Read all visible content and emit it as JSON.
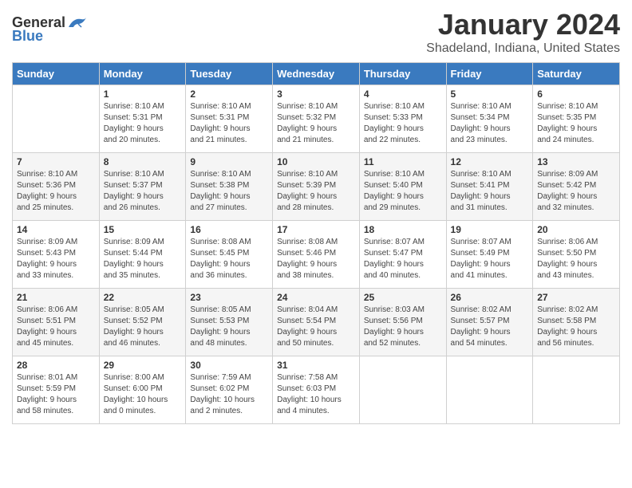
{
  "header": {
    "logo_general": "General",
    "logo_blue": "Blue",
    "month_title": "January 2024",
    "location": "Shadeland, Indiana, United States"
  },
  "days_of_week": [
    "Sunday",
    "Monday",
    "Tuesday",
    "Wednesday",
    "Thursday",
    "Friday",
    "Saturday"
  ],
  "weeks": [
    [
      {
        "day": "",
        "info": ""
      },
      {
        "day": "1",
        "info": "Sunrise: 8:10 AM\nSunset: 5:31 PM\nDaylight: 9 hours\nand 20 minutes."
      },
      {
        "day": "2",
        "info": "Sunrise: 8:10 AM\nSunset: 5:31 PM\nDaylight: 9 hours\nand 21 minutes."
      },
      {
        "day": "3",
        "info": "Sunrise: 8:10 AM\nSunset: 5:32 PM\nDaylight: 9 hours\nand 21 minutes."
      },
      {
        "day": "4",
        "info": "Sunrise: 8:10 AM\nSunset: 5:33 PM\nDaylight: 9 hours\nand 22 minutes."
      },
      {
        "day": "5",
        "info": "Sunrise: 8:10 AM\nSunset: 5:34 PM\nDaylight: 9 hours\nand 23 minutes."
      },
      {
        "day": "6",
        "info": "Sunrise: 8:10 AM\nSunset: 5:35 PM\nDaylight: 9 hours\nand 24 minutes."
      }
    ],
    [
      {
        "day": "7",
        "info": "Sunrise: 8:10 AM\nSunset: 5:36 PM\nDaylight: 9 hours\nand 25 minutes."
      },
      {
        "day": "8",
        "info": "Sunrise: 8:10 AM\nSunset: 5:37 PM\nDaylight: 9 hours\nand 26 minutes."
      },
      {
        "day": "9",
        "info": "Sunrise: 8:10 AM\nSunset: 5:38 PM\nDaylight: 9 hours\nand 27 minutes."
      },
      {
        "day": "10",
        "info": "Sunrise: 8:10 AM\nSunset: 5:39 PM\nDaylight: 9 hours\nand 28 minutes."
      },
      {
        "day": "11",
        "info": "Sunrise: 8:10 AM\nSunset: 5:40 PM\nDaylight: 9 hours\nand 29 minutes."
      },
      {
        "day": "12",
        "info": "Sunrise: 8:10 AM\nSunset: 5:41 PM\nDaylight: 9 hours\nand 31 minutes."
      },
      {
        "day": "13",
        "info": "Sunrise: 8:09 AM\nSunset: 5:42 PM\nDaylight: 9 hours\nand 32 minutes."
      }
    ],
    [
      {
        "day": "14",
        "info": "Sunrise: 8:09 AM\nSunset: 5:43 PM\nDaylight: 9 hours\nand 33 minutes."
      },
      {
        "day": "15",
        "info": "Sunrise: 8:09 AM\nSunset: 5:44 PM\nDaylight: 9 hours\nand 35 minutes."
      },
      {
        "day": "16",
        "info": "Sunrise: 8:08 AM\nSunset: 5:45 PM\nDaylight: 9 hours\nand 36 minutes."
      },
      {
        "day": "17",
        "info": "Sunrise: 8:08 AM\nSunset: 5:46 PM\nDaylight: 9 hours\nand 38 minutes."
      },
      {
        "day": "18",
        "info": "Sunrise: 8:07 AM\nSunset: 5:47 PM\nDaylight: 9 hours\nand 40 minutes."
      },
      {
        "day": "19",
        "info": "Sunrise: 8:07 AM\nSunset: 5:49 PM\nDaylight: 9 hours\nand 41 minutes."
      },
      {
        "day": "20",
        "info": "Sunrise: 8:06 AM\nSunset: 5:50 PM\nDaylight: 9 hours\nand 43 minutes."
      }
    ],
    [
      {
        "day": "21",
        "info": "Sunrise: 8:06 AM\nSunset: 5:51 PM\nDaylight: 9 hours\nand 45 minutes."
      },
      {
        "day": "22",
        "info": "Sunrise: 8:05 AM\nSunset: 5:52 PM\nDaylight: 9 hours\nand 46 minutes."
      },
      {
        "day": "23",
        "info": "Sunrise: 8:05 AM\nSunset: 5:53 PM\nDaylight: 9 hours\nand 48 minutes."
      },
      {
        "day": "24",
        "info": "Sunrise: 8:04 AM\nSunset: 5:54 PM\nDaylight: 9 hours\nand 50 minutes."
      },
      {
        "day": "25",
        "info": "Sunrise: 8:03 AM\nSunset: 5:56 PM\nDaylight: 9 hours\nand 52 minutes."
      },
      {
        "day": "26",
        "info": "Sunrise: 8:02 AM\nSunset: 5:57 PM\nDaylight: 9 hours\nand 54 minutes."
      },
      {
        "day": "27",
        "info": "Sunrise: 8:02 AM\nSunset: 5:58 PM\nDaylight: 9 hours\nand 56 minutes."
      }
    ],
    [
      {
        "day": "28",
        "info": "Sunrise: 8:01 AM\nSunset: 5:59 PM\nDaylight: 9 hours\nand 58 minutes."
      },
      {
        "day": "29",
        "info": "Sunrise: 8:00 AM\nSunset: 6:00 PM\nDaylight: 10 hours\nand 0 minutes."
      },
      {
        "day": "30",
        "info": "Sunrise: 7:59 AM\nSunset: 6:02 PM\nDaylight: 10 hours\nand 2 minutes."
      },
      {
        "day": "31",
        "info": "Sunrise: 7:58 AM\nSunset: 6:03 PM\nDaylight: 10 hours\nand 4 minutes."
      },
      {
        "day": "",
        "info": ""
      },
      {
        "day": "",
        "info": ""
      },
      {
        "day": "",
        "info": ""
      }
    ]
  ]
}
